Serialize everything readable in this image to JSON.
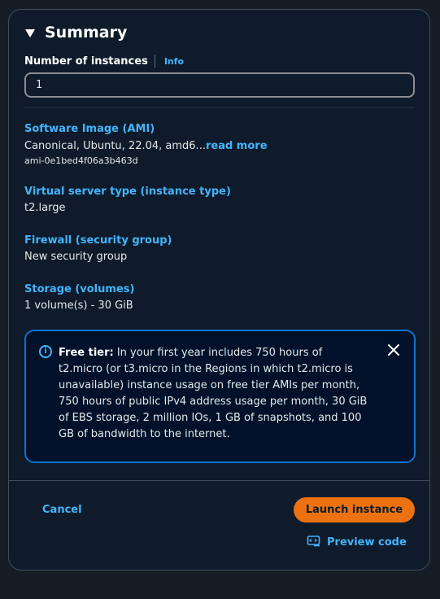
{
  "summary": {
    "title": "Summary",
    "instances_label": "Number of instances",
    "info_link": "Info",
    "instances_value": "1"
  },
  "sections": {
    "ami": {
      "title": "Software Image (AMI)",
      "value": "Canonical, Ubuntu, 22.04, amd6...",
      "read_more": "read more",
      "id": "ami-0e1bed4f06a3b463d"
    },
    "instance_type": {
      "title": "Virtual server type (instance type)",
      "value": "t2.large"
    },
    "firewall": {
      "title": "Firewall (security group)",
      "value": "New security group"
    },
    "storage": {
      "title": "Storage (volumes)",
      "value": "1 volume(s) - 30 GiB"
    }
  },
  "alert": {
    "bold": "Free tier:",
    "text": " In your first year includes 750 hours of t2.micro (or t3.micro in the Regions in which t2.micro is unavailable) instance usage on free tier AMIs per month, 750 hours of public IPv4 address usage per month, 30 GiB of EBS storage, 2 million IOs, 1 GB of snapshots, and 100 GB of bandwidth to the internet."
  },
  "footer": {
    "cancel": "Cancel",
    "launch": "Launch instance",
    "preview": "Preview code"
  },
  "colors": {
    "accent": "#42b4ff",
    "primary_button": "#ec7211",
    "alert_border": "#0972d3"
  },
  "icons": {
    "collapse": "caret-down-icon",
    "alert": "info-icon",
    "close": "close-icon",
    "preview": "code-icon"
  }
}
